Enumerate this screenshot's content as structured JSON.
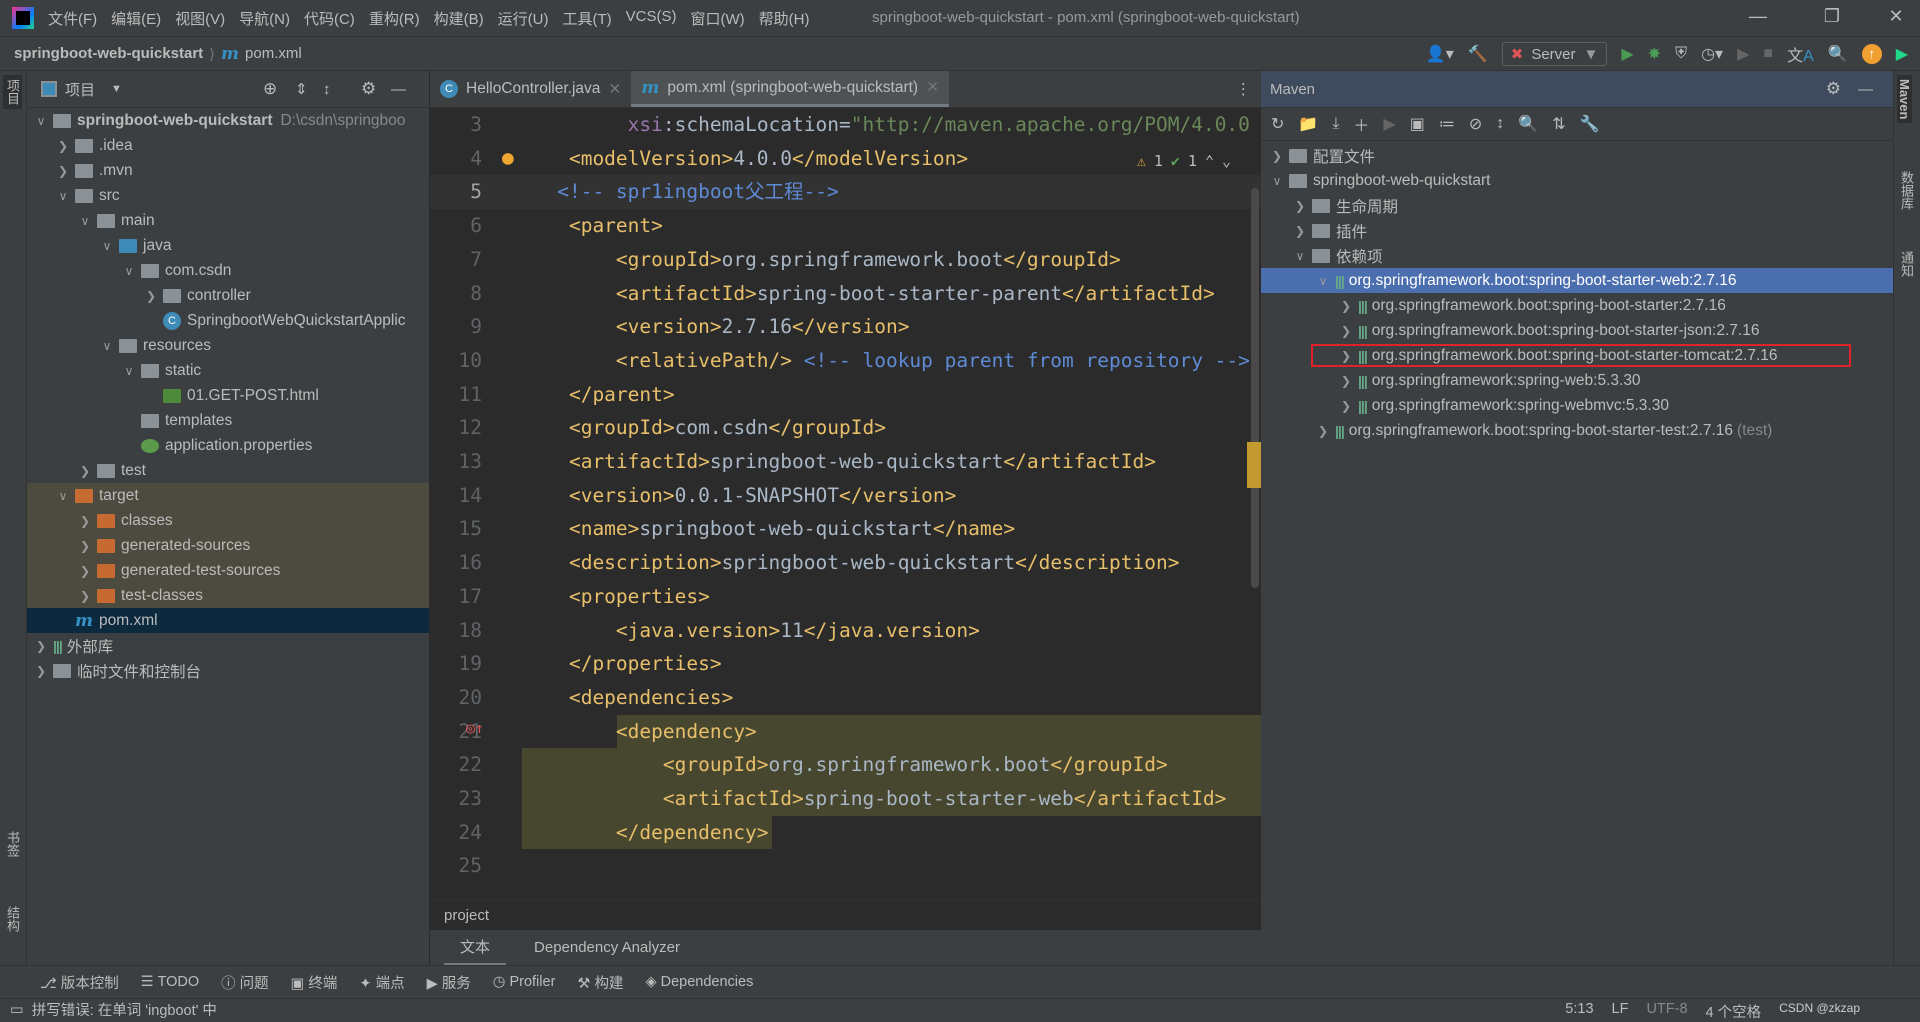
{
  "menubar": {
    "items": [
      "文件(F)",
      "编辑(E)",
      "视图(V)",
      "导航(N)",
      "代码(C)",
      "重构(R)",
      "构建(B)",
      "运行(U)",
      "工具(T)",
      "VCS(S)",
      "窗口(W)",
      "帮助(H)"
    ],
    "title": "springboot-web-quickstart - pom.xml (springboot-web-quickstart)"
  },
  "navbar": {
    "project": "springboot-web-quickstart",
    "file": "pom.xml",
    "run_config": "Server"
  },
  "left_stripe": {
    "project": "项目",
    "bookmarks": "书签",
    "structure": "结构"
  },
  "project_panel": {
    "title": "项目",
    "tree": [
      {
        "depth": 0,
        "chev": "v",
        "icon": "module-folder",
        "label": "springboot-web-quickstart",
        "hint": "D:\\csdn\\springboo",
        "bold": true
      },
      {
        "depth": 1,
        "chev": ">",
        "icon": "folder",
        "label": ".idea"
      },
      {
        "depth": 1,
        "chev": ">",
        "icon": "folder",
        "label": ".mvn"
      },
      {
        "depth": 1,
        "chev": "v",
        "icon": "folder",
        "label": "src"
      },
      {
        "depth": 2,
        "chev": "v",
        "icon": "folder",
        "label": "main"
      },
      {
        "depth": 3,
        "chev": "v",
        "icon": "source-folder",
        "label": "java"
      },
      {
        "depth": 4,
        "chev": "v",
        "icon": "package",
        "label": "com.csdn"
      },
      {
        "depth": 5,
        "chev": ">",
        "icon": "package",
        "label": "controller"
      },
      {
        "depth": 5,
        "chev": "",
        "icon": "spring-class",
        "label": "SpringbootWebQuickstartApplic"
      },
      {
        "depth": 3,
        "chev": "v",
        "icon": "resources-folder",
        "label": "resources"
      },
      {
        "depth": 4,
        "chev": "v",
        "icon": "folder",
        "label": "static"
      },
      {
        "depth": 5,
        "chev": "",
        "icon": "html-file",
        "label": "01.GET-POST.html"
      },
      {
        "depth": 4,
        "chev": "",
        "icon": "folder",
        "label": "templates"
      },
      {
        "depth": 4,
        "chev": "",
        "icon": "spring-properties",
        "label": "application.properties"
      },
      {
        "depth": 2,
        "chev": ">",
        "icon": "folder",
        "label": "test"
      },
      {
        "depth": 1,
        "chev": "v",
        "icon": "excluded-folder",
        "label": "target",
        "excluded": true
      },
      {
        "depth": 2,
        "chev": ">",
        "icon": "excluded-folder",
        "label": "classes",
        "excluded": true
      },
      {
        "depth": 2,
        "chev": ">",
        "icon": "excluded-folder",
        "label": "generated-sources",
        "excluded": true
      },
      {
        "depth": 2,
        "chev": ">",
        "icon": "excluded-folder",
        "label": "generated-test-sources",
        "excluded": true
      },
      {
        "depth": 2,
        "chev": ">",
        "icon": "excluded-folder",
        "label": "test-classes",
        "excluded": true
      },
      {
        "depth": 1,
        "chev": "",
        "icon": "maven-file",
        "label": "pom.xml",
        "selected": true
      },
      {
        "depth": 0,
        "chev": ">",
        "icon": "library",
        "label": "外部库"
      },
      {
        "depth": 0,
        "chev": ">",
        "icon": "scratch",
        "label": "临时文件和控制台"
      }
    ]
  },
  "editor": {
    "tabs": [
      {
        "label": "HelloController.java",
        "icon": "class"
      },
      {
        "label": "pom.xml (springboot-web-quickstart)",
        "icon": "maven",
        "active": true
      }
    ],
    "inspections": {
      "warnings": "1",
      "typos": "1"
    },
    "lines": [
      {
        "n": "3",
        "tokens": [
          [
            "txt",
            "         "
          ],
          [
            "attr",
            "xsi"
          ],
          [
            "txt",
            ":schemaLocation="
          ],
          [
            "str",
            "\"http://maven.apache.org/POM/4.0.0"
          ]
        ]
      },
      {
        "n": "4",
        "tokens": [
          [
            "tag",
            "    <modelVersion>"
          ],
          [
            "txt",
            "4.0.0"
          ],
          [
            "tag",
            "</modelVersion>"
          ]
        ]
      },
      {
        "n": "5",
        "current": true,
        "tokens": [
          [
            "cmt",
            "   <!-- spr1ingboot父工程-->"
          ]
        ]
      },
      {
        "n": "6",
        "tokens": [
          [
            "tag",
            "    <parent>"
          ]
        ]
      },
      {
        "n": "7",
        "tokens": [
          [
            "tag",
            "        <groupId>"
          ],
          [
            "txt",
            "org.springframework.boot"
          ],
          [
            "tag",
            "</groupId>"
          ]
        ]
      },
      {
        "n": "8",
        "tokens": [
          [
            "tag",
            "        <artifactId>"
          ],
          [
            "txt",
            "spring-boot-starter-parent"
          ],
          [
            "tag",
            "</artifactId>"
          ]
        ]
      },
      {
        "n": "9",
        "tokens": [
          [
            "tag",
            "        <version>"
          ],
          [
            "txt",
            "2.7.16"
          ],
          [
            "tag",
            "</version>"
          ]
        ]
      },
      {
        "n": "10",
        "tokens": [
          [
            "tag",
            "        <relativePath/>"
          ],
          [
            "cmt",
            " <!-- lookup parent from repository -->"
          ]
        ]
      },
      {
        "n": "11",
        "tokens": [
          [
            "tag",
            "    </parent>"
          ]
        ]
      },
      {
        "n": "12",
        "tokens": [
          [
            "tag",
            "    <groupId>"
          ],
          [
            "txt",
            "com.csdn"
          ],
          [
            "tag",
            "</groupId>"
          ]
        ]
      },
      {
        "n": "13",
        "tokens": [
          [
            "tag",
            "    <artifactId>"
          ],
          [
            "txt",
            "springboot-web-quickstart"
          ],
          [
            "tag",
            "</artifactId>"
          ]
        ]
      },
      {
        "n": "14",
        "tokens": [
          [
            "tag",
            "    <version>"
          ],
          [
            "txt",
            "0.0.1-SNAPSHOT"
          ],
          [
            "tag",
            "</version>"
          ]
        ]
      },
      {
        "n": "15",
        "tokens": [
          [
            "tag",
            "    <name>"
          ],
          [
            "txt",
            "springboot-web-quickstart"
          ],
          [
            "tag",
            "</name>"
          ]
        ]
      },
      {
        "n": "16",
        "tokens": [
          [
            "tag",
            "    <description>"
          ],
          [
            "txt",
            "springboot-web-quickstart"
          ],
          [
            "tag",
            "</description>"
          ]
        ]
      },
      {
        "n": "17",
        "tokens": [
          [
            "tag",
            "    <properties>"
          ]
        ]
      },
      {
        "n": "18",
        "tokens": [
          [
            "tag",
            "        <java.version>"
          ],
          [
            "txt",
            "11"
          ],
          [
            "tag",
            "</java.version>"
          ]
        ]
      },
      {
        "n": "19",
        "tokens": [
          [
            "tag",
            "    </properties>"
          ]
        ]
      },
      {
        "n": "20",
        "tokens": [
          [
            "tag",
            "    <dependencies>"
          ]
        ]
      },
      {
        "n": "21",
        "highlight": true,
        "tokens": [
          [
            "tag",
            "        <dependency>"
          ]
        ]
      },
      {
        "n": "22",
        "highlight": true,
        "tokens": [
          [
            "tag",
            "            <groupId>"
          ],
          [
            "txt",
            "org.springframework.boot"
          ],
          [
            "tag",
            "</groupId>"
          ]
        ]
      },
      {
        "n": "23",
        "highlight": true,
        "tokens": [
          [
            "tag",
            "            <artifactId>"
          ],
          [
            "txt",
            "spring-boot-starter-web"
          ],
          [
            "tag",
            "</artifactId>"
          ]
        ]
      },
      {
        "n": "24",
        "highlight": true,
        "tokens": [
          [
            "tag",
            "        </dependency>"
          ]
        ]
      },
      {
        "n": "25",
        "tokens": []
      }
    ],
    "breadcrumb": "project",
    "bottom_tabs": [
      "文本",
      "Dependency Analyzer"
    ]
  },
  "maven": {
    "title": "Maven",
    "tree": [
      {
        "depth": 0,
        "chev": ">",
        "label": "配置文件",
        "icon": "profiles"
      },
      {
        "depth": 0,
        "chev": "v",
        "label": "springboot-web-quickstart",
        "icon": "maven-project"
      },
      {
        "depth": 1,
        "chev": ">",
        "label": "生命周期",
        "icon": "lifecycle"
      },
      {
        "depth": 1,
        "chev": ">",
        "label": "插件",
        "icon": "plugins"
      },
      {
        "depth": 1,
        "chev": "v",
        "label": "依赖项",
        "icon": "dependencies"
      },
      {
        "depth": 2,
        "chev": "v",
        "label": "org.springframework.boot:spring-boot-starter-web:2.7.16",
        "icon": "dependency",
        "selected": true
      },
      {
        "depth": 3,
        "chev": ">",
        "label": "org.springframework.boot:spring-boot-starter:2.7.16",
        "icon": "dependency"
      },
      {
        "depth": 3,
        "chev": ">",
        "label": "org.springframework.boot:spring-boot-starter-json:2.7.16",
        "icon": "dependency"
      },
      {
        "depth": 3,
        "chev": ">",
        "label": "org.springframework.boot:spring-boot-starter-tomcat:2.7.16",
        "icon": "dependency",
        "boxed": true
      },
      {
        "depth": 3,
        "chev": ">",
        "label": "org.springframework:spring-web:5.3.30",
        "icon": "dependency"
      },
      {
        "depth": 3,
        "chev": ">",
        "label": "org.springframework:spring-webmvc:5.3.30",
        "icon": "dependency"
      },
      {
        "depth": 2,
        "chev": ">",
        "label": "org.springframework.boot:spring-boot-starter-test:2.7.16",
        "icon": "dependency",
        "hint": "(test)"
      }
    ]
  },
  "right_stripe": {
    "maven": "Maven",
    "database": "数据库",
    "notifications": "通知"
  },
  "bottom_tools": [
    "版本控制",
    "TODO",
    "问题",
    "终端",
    "端点",
    "服务",
    "Profiler",
    "构建",
    "Dependencies"
  ],
  "status": {
    "message": "拼写错误: 在单词 'ingboot' 中",
    "position": "5:13",
    "line_sep": "LF",
    "encoding": "UTF-8",
    "indent": "4 个空格",
    "watermark": "CSDN @zkzap"
  },
  "colors": {
    "accent": "#4b6eaf",
    "tag": "#e8bf6a",
    "highlight_box": "#e0232b"
  }
}
